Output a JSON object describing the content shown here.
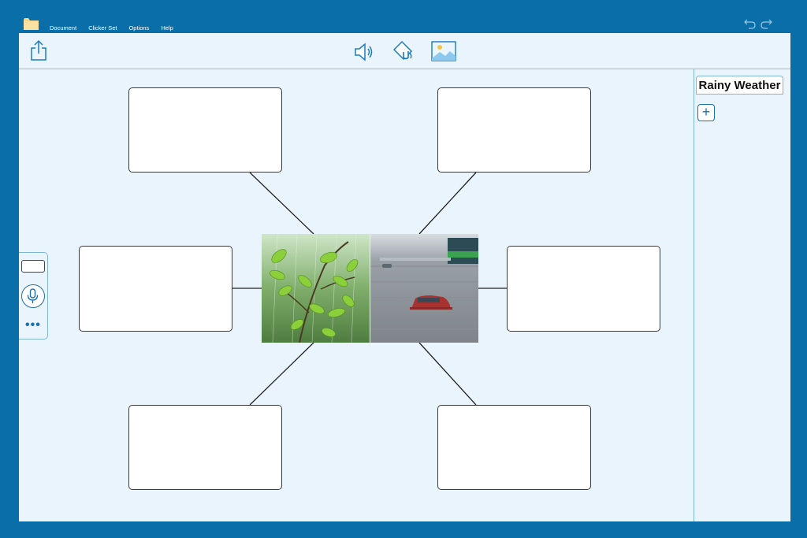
{
  "menu": {
    "items": [
      "Document",
      "Clicker Set",
      "Options",
      "Help"
    ]
  },
  "icons": {
    "folder": "folder-icon",
    "undo": "undo-icon",
    "redo": "redo-icon",
    "share": "share-icon",
    "speaker": "speaker-icon",
    "fill": "paint-bucket-icon",
    "picture": "picture-icon",
    "microphone": "microphone-icon",
    "more": "more-icon",
    "add": "plus-icon"
  },
  "set": {
    "title": "Rainy Weather",
    "add_label": "+"
  },
  "side": {
    "more_label": "•••"
  },
  "colors": {
    "frame": "#0a6ea8",
    "panel": "#eaf4fd",
    "accent": "#1a6fb0"
  }
}
